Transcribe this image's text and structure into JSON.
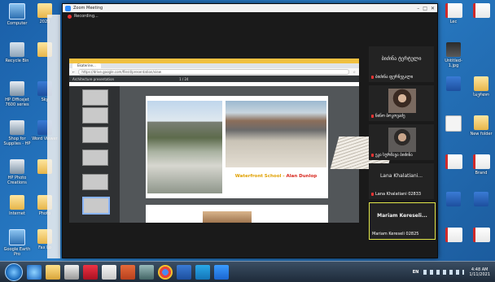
{
  "desktop": {
    "left_icons": [
      {
        "label": "Computer",
        "glyph": "computer-icon"
      },
      {
        "label": "Recycle Bin",
        "glyph": "recycle-bin-icon"
      },
      {
        "label": "HP Officejet 7600 series",
        "glyph": "printer-icon"
      },
      {
        "label": "Shop for Supplies - HP",
        "glyph": "printer-icon"
      },
      {
        "label": "HP Photo Creations",
        "glyph": "printer-icon"
      },
      {
        "label": "Internet",
        "glyph": "folder-icon"
      },
      {
        "label": "Google Earth Pro",
        "glyph": "globe-icon"
      }
    ],
    "left_icons_col2": [
      {
        "label": "2020",
        "glyph": "folder-icon"
      },
      {
        "label": "",
        "glyph": "folder-icon"
      },
      {
        "label": "Sky",
        "glyph": "skype-icon"
      },
      {
        "label": "Word Viewer",
        "glyph": "word-icon"
      },
      {
        "label": "",
        "glyph": "folder-icon"
      },
      {
        "label": "Photo",
        "glyph": "folder-icon"
      },
      {
        "label": "Fax Lo",
        "glyph": "folder-icon"
      }
    ],
    "right_icons": [
      {
        "label": "",
        "glyph": "pdf-icon"
      },
      {
        "label": "",
        "glyph": "pdf-icon"
      },
      {
        "label": "Untitled-1.jpg",
        "glyph": "image-icon"
      },
      {
        "label": "",
        "glyph": "folder-icon"
      },
      {
        "label": "",
        "glyph": "word-icon"
      },
      {
        "label": "",
        "glyph": "pdf-icon"
      },
      {
        "label": "",
        "glyph": "word-icon"
      },
      {
        "label": "",
        "glyph": "word-icon"
      }
    ],
    "right_icons_col2": [
      {
        "label": "Lec",
        "glyph": "pdf-icon"
      },
      {
        "label": "",
        "glyph": "folder-icon"
      },
      {
        "label": "საერთო",
        "glyph": "folder-icon"
      },
      {
        "label": "New folder",
        "glyph": "folder-icon"
      },
      {
        "label": "Brand",
        "glyph": "pdf-icon"
      },
      {
        "label": "",
        "glyph": "word-icon"
      },
      {
        "label": "",
        "glyph": "pdf-icon"
      }
    ]
  },
  "zoom": {
    "window_title": "Zoom Meeting",
    "recording_label": "Recording...",
    "browser": {
      "tab_label": "Ekaterine...",
      "url": "https://drive.google.com/file/d/presentation/view",
      "viewer_title": "Architecture presentation",
      "page_indicator": "1 / 24",
      "slide_caption_part1": "Waterfront School - ",
      "slide_caption_part2": "Alan Dunlop"
    },
    "participants": [
      {
        "name": "ბიძინა ფერნეგალი",
        "top_name": "ბიძინა ტერტული",
        "kind": "name-only"
      },
      {
        "name": "ნინო ბოკოვაძე",
        "kind": "video",
        "face": "woman"
      },
      {
        "name": "ეკა სურმავა ბიძინა",
        "kind": "video",
        "face": "man"
      },
      {
        "name": "Lana Khalatiani 02833",
        "big_label": "Lana Khalatiani...",
        "kind": "name-only"
      },
      {
        "name": "Mariam Kereseli 02825",
        "big_label": "Mariam Kereseli...",
        "kind": "active"
      }
    ]
  },
  "taskbar": {
    "language": "EN",
    "time": "4:48 AM",
    "date": "1/11/2021"
  }
}
